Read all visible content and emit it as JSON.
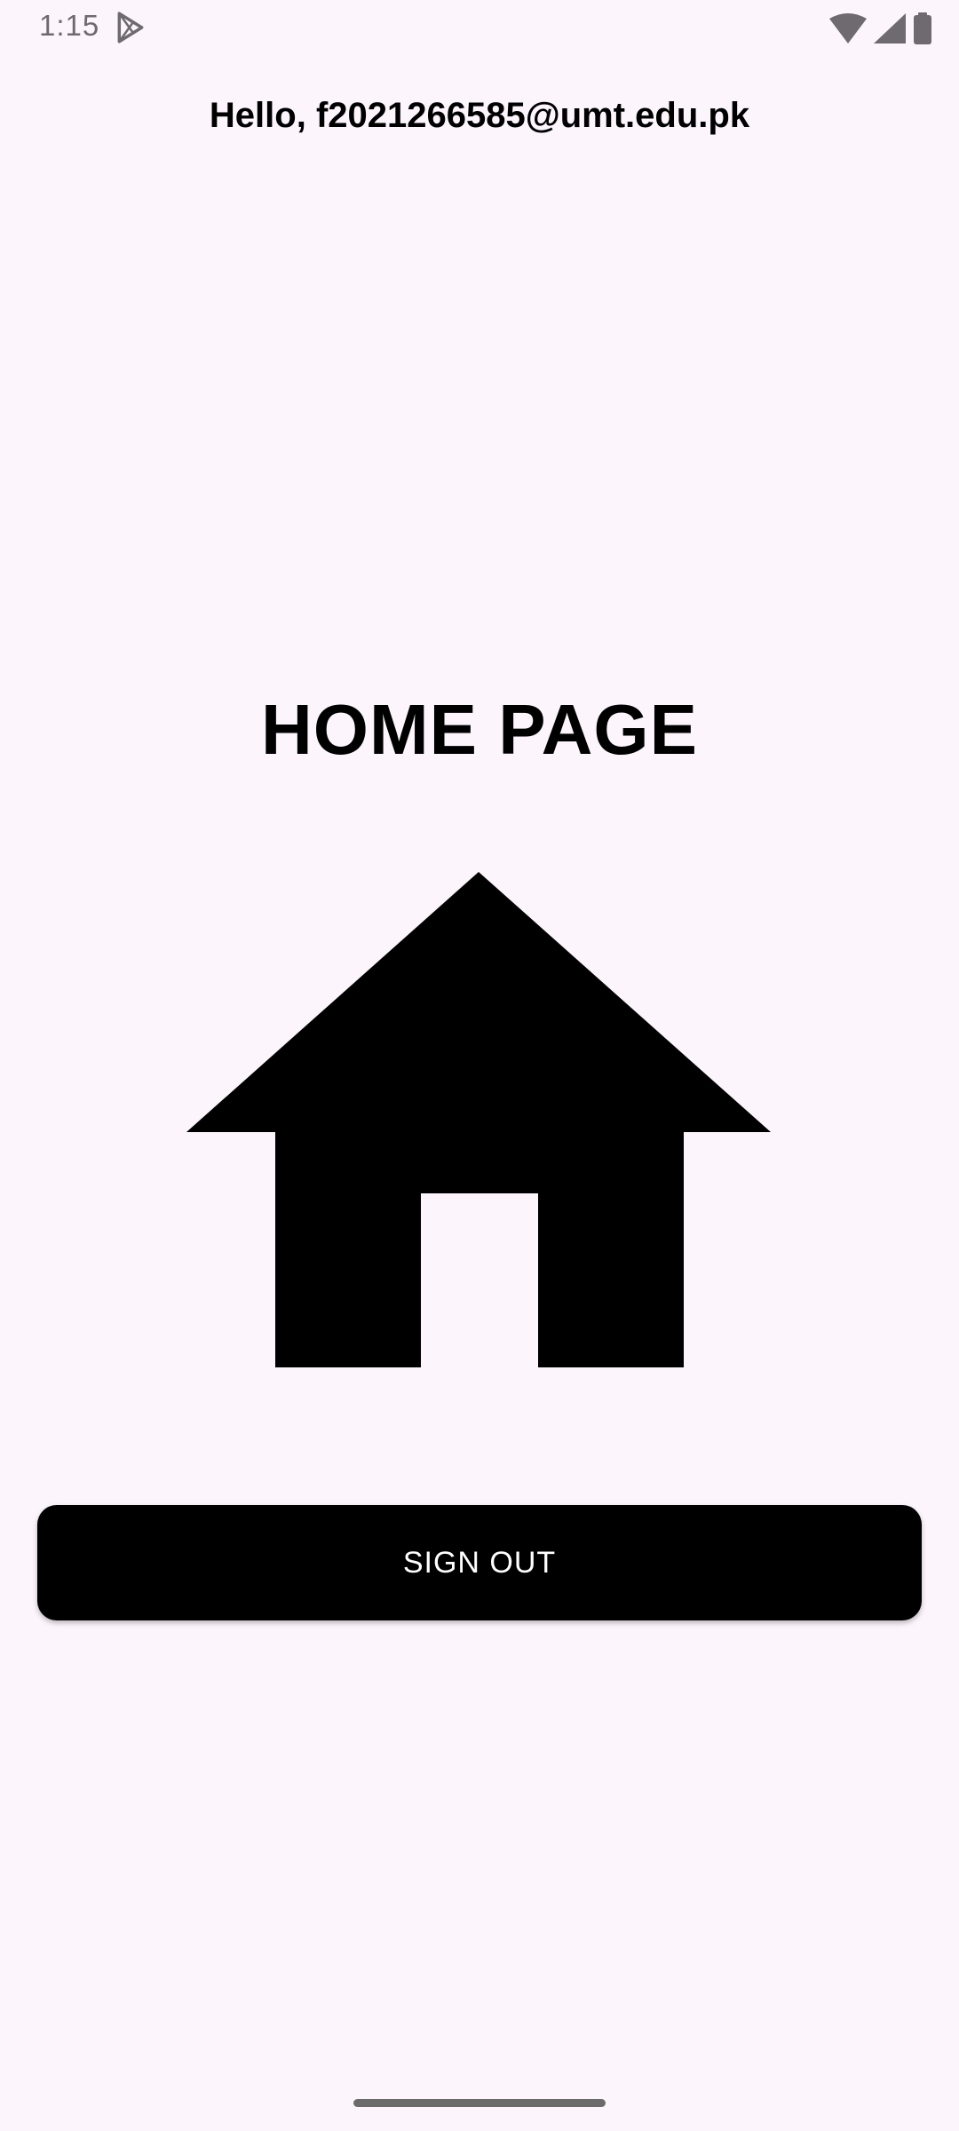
{
  "status_bar": {
    "time": "1:15",
    "icons": [
      "play-store-icon",
      "wifi-icon",
      "signal-icon",
      "battery-icon"
    ]
  },
  "header": {
    "greeting": "Hello, f2021266585@umt.edu.pk"
  },
  "main": {
    "title": "HOME PAGE",
    "icon": "home-icon",
    "sign_out_label": "SIGN OUT"
  },
  "colors": {
    "background": "#fcf5fc",
    "button": "#000000",
    "button_text": "#ffffff",
    "status_icons": "#6f6a70"
  }
}
